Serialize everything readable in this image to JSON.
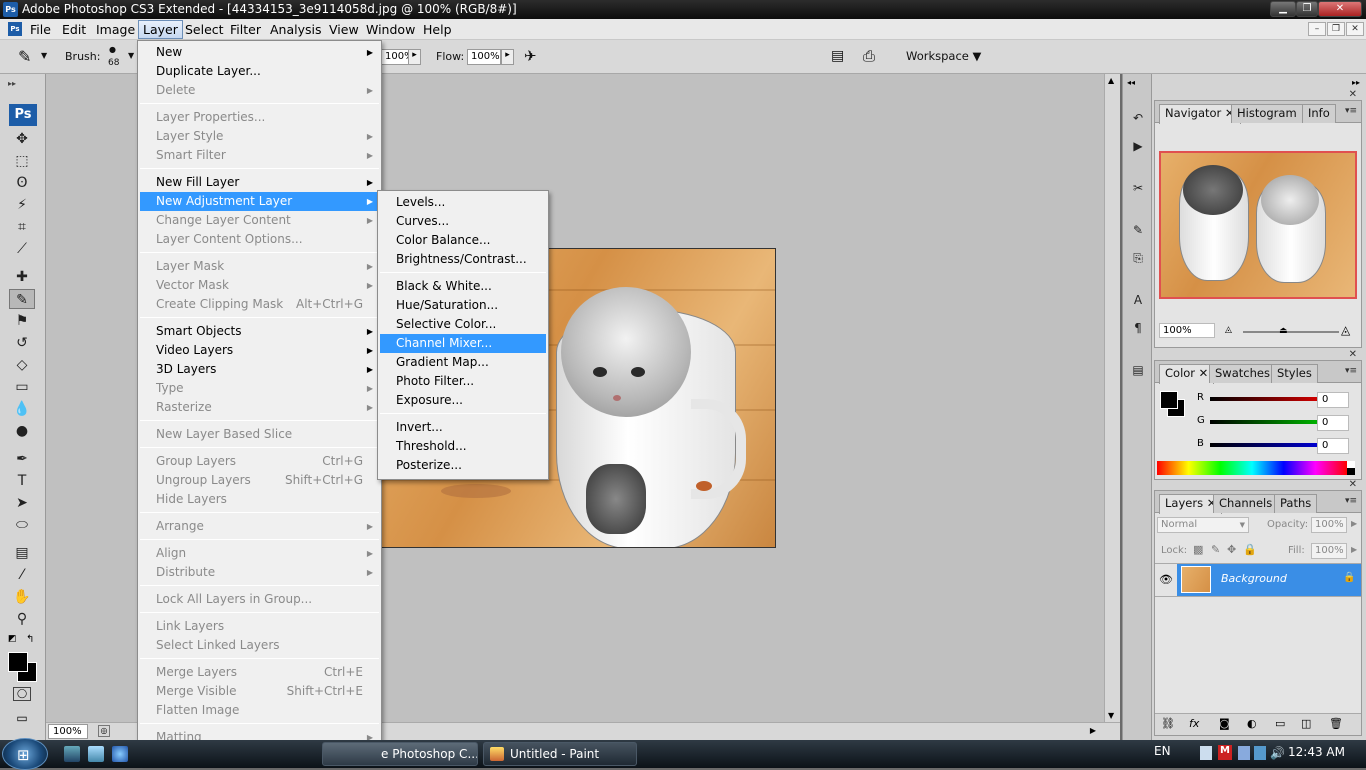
{
  "window": {
    "title": "Adobe Photoshop CS3 Extended - [44334153_3e9114058d.jpg @ 100% (RGB/8#)]",
    "app_icon": "Ps"
  },
  "menubar": {
    "items": [
      "File",
      "Edit",
      "Image",
      "Layer",
      "Select",
      "Filter",
      "Analysis",
      "View",
      "Window",
      "Help"
    ]
  },
  "options": {
    "brush_label": "Brush:",
    "brush_size": "68",
    "opacity_value": "100%",
    "flow_label": "Flow:",
    "flow_value": "100%",
    "workspace": "Workspace"
  },
  "toolbox": {
    "logo": "Ps"
  },
  "layer_menu": [
    {
      "type": "item",
      "label": "New",
      "arrow": true
    },
    {
      "type": "item",
      "label": "Duplicate Layer..."
    },
    {
      "type": "item",
      "label": "Delete",
      "disabled": true,
      "arrow": true
    },
    {
      "type": "sep"
    },
    {
      "type": "item",
      "label": "Layer Properties...",
      "disabled": true
    },
    {
      "type": "item",
      "label": "Layer Style",
      "disabled": true,
      "arrow": true
    },
    {
      "type": "item",
      "label": "Smart Filter",
      "disabled": true,
      "arrow": true
    },
    {
      "type": "sep"
    },
    {
      "type": "item",
      "label": "New Fill Layer",
      "arrow": true
    },
    {
      "type": "item",
      "label": "New Adjustment Layer",
      "arrow": true,
      "highlight": true
    },
    {
      "type": "item",
      "label": "Change Layer Content",
      "disabled": true,
      "arrow": true
    },
    {
      "type": "item",
      "label": "Layer Content Options...",
      "disabled": true
    },
    {
      "type": "sep"
    },
    {
      "type": "item",
      "label": "Layer Mask",
      "disabled": true,
      "arrow": true
    },
    {
      "type": "item",
      "label": "Vector Mask",
      "disabled": true,
      "arrow": true
    },
    {
      "type": "item",
      "label": "Create Clipping Mask",
      "disabled": true,
      "shortcut": "Alt+Ctrl+G"
    },
    {
      "type": "sep"
    },
    {
      "type": "item",
      "label": "Smart Objects",
      "arrow": true
    },
    {
      "type": "item",
      "label": "Video Layers",
      "arrow": true
    },
    {
      "type": "item",
      "label": "3D Layers",
      "arrow": true
    },
    {
      "type": "item",
      "label": "Type",
      "disabled": true,
      "arrow": true
    },
    {
      "type": "item",
      "label": "Rasterize",
      "disabled": true,
      "arrow": true
    },
    {
      "type": "sep"
    },
    {
      "type": "item",
      "label": "New Layer Based Slice",
      "disabled": true
    },
    {
      "type": "sep"
    },
    {
      "type": "item",
      "label": "Group Layers",
      "disabled": true,
      "shortcut": "Ctrl+G"
    },
    {
      "type": "item",
      "label": "Ungroup Layers",
      "disabled": true,
      "shortcut": "Shift+Ctrl+G"
    },
    {
      "type": "item",
      "label": "Hide Layers",
      "disabled": true
    },
    {
      "type": "sep"
    },
    {
      "type": "item",
      "label": "Arrange",
      "disabled": true,
      "arrow": true
    },
    {
      "type": "sep"
    },
    {
      "type": "item",
      "label": "Align",
      "disabled": true,
      "arrow": true
    },
    {
      "type": "item",
      "label": "Distribute",
      "disabled": true,
      "arrow": true
    },
    {
      "type": "sep"
    },
    {
      "type": "item",
      "label": "Lock All Layers in Group...",
      "disabled": true
    },
    {
      "type": "sep"
    },
    {
      "type": "item",
      "label": "Link Layers",
      "disabled": true
    },
    {
      "type": "item",
      "label": "Select Linked Layers",
      "disabled": true
    },
    {
      "type": "sep"
    },
    {
      "type": "item",
      "label": "Merge Layers",
      "disabled": true,
      "shortcut": "Ctrl+E"
    },
    {
      "type": "item",
      "label": "Merge Visible",
      "disabled": true,
      "shortcut": "Shift+Ctrl+E"
    },
    {
      "type": "item",
      "label": "Flatten Image",
      "disabled": true
    },
    {
      "type": "sep"
    },
    {
      "type": "item",
      "label": "Matting",
      "disabled": true,
      "arrow": true
    }
  ],
  "adjustment_submenu": [
    {
      "type": "item",
      "label": "Levels..."
    },
    {
      "type": "item",
      "label": "Curves..."
    },
    {
      "type": "item",
      "label": "Color Balance..."
    },
    {
      "type": "item",
      "label": "Brightness/Contrast..."
    },
    {
      "type": "sep"
    },
    {
      "type": "item",
      "label": "Black & White..."
    },
    {
      "type": "item",
      "label": "Hue/Saturation..."
    },
    {
      "type": "item",
      "label": "Selective Color..."
    },
    {
      "type": "item",
      "label": "Channel Mixer...",
      "highlight": true
    },
    {
      "type": "item",
      "label": "Gradient Map..."
    },
    {
      "type": "item",
      "label": "Photo Filter..."
    },
    {
      "type": "item",
      "label": "Exposure..."
    },
    {
      "type": "sep"
    },
    {
      "type": "item",
      "label": "Invert..."
    },
    {
      "type": "item",
      "label": "Threshold..."
    },
    {
      "type": "item",
      "label": "Posterize..."
    }
  ],
  "status": {
    "zoom": "100%"
  },
  "navigator_panel": {
    "tabs": [
      "Navigator",
      "Histogram",
      "Info"
    ],
    "zoom": "100%"
  },
  "color_panel": {
    "tabs": [
      "Color",
      "Swatches",
      "Styles"
    ],
    "channels": [
      {
        "label": "R",
        "value": "0",
        "color": "#d00000"
      },
      {
        "label": "G",
        "value": "0",
        "color": "#00a000"
      },
      {
        "label": "B",
        "value": "0",
        "color": "#0000d0"
      }
    ]
  },
  "layers_panel": {
    "tabs": [
      "Layers",
      "Channels",
      "Paths"
    ],
    "blend_mode": "Normal",
    "opacity_label": "Opacity:",
    "opacity": "100%",
    "lock_label": "Lock:",
    "fill_label": "Fill:",
    "fill": "100%",
    "layer_name": "Background"
  },
  "taskbar": {
    "photoshop_btn": "e Photoshop C...",
    "paint_btn": "Untitled - Paint",
    "lang": "EN",
    "time": "12:43 AM"
  }
}
